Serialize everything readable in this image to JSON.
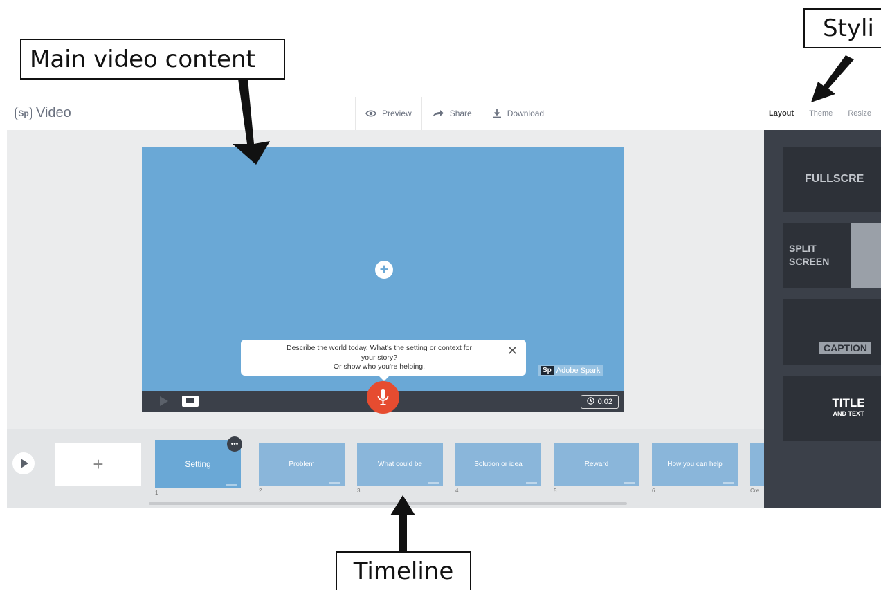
{
  "annotations": {
    "main_video_content": "Main video content",
    "styling": "Styli",
    "timeline": "Timeline"
  },
  "app": {
    "logo": "Sp",
    "name": "Video"
  },
  "toolbar": {
    "preview_label": "Preview",
    "share_label": "Share",
    "download_label": "Download"
  },
  "style_tabs": {
    "layout": "Layout",
    "theme": "Theme",
    "resize": "Resize"
  },
  "stage": {
    "prompt_line1": "Describe the world today. What's the setting or context for",
    "prompt_line2": "your story?",
    "prompt_line3": "Or show who you're helping.",
    "prompt_close": "✕",
    "add_icon": "+",
    "watermark_logo": "Sp",
    "watermark_text": "Adobe Spark",
    "duration": "0:02"
  },
  "timeline": {
    "add_slide": "+",
    "more_icon": "•••",
    "slides": [
      {
        "label": "Setting",
        "number": "1"
      },
      {
        "label": "Problem",
        "number": "2"
      },
      {
        "label": "What could be",
        "number": "3"
      },
      {
        "label": "Solution or idea",
        "number": "4"
      },
      {
        "label": "Reward",
        "number": "5"
      },
      {
        "label": "How you can help",
        "number": "6"
      },
      {
        "label": "",
        "number": "Cre"
      }
    ]
  },
  "layouts": {
    "fullscreen": "FULLSCRE",
    "split_line1": "SPLIT",
    "split_line2": "SCREEN",
    "caption": "CAPTION",
    "title": "TITLE",
    "title_sub": "AND TEXT"
  },
  "colors": {
    "stage_blue": "#6aa8d6",
    "mic_red": "#e64c30",
    "panel_dark": "#3b4049"
  }
}
